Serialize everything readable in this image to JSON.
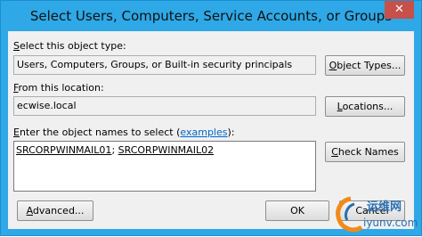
{
  "window": {
    "title": "Select Users, Computers, Service Accounts, or Groups",
    "close_glyph": "✕"
  },
  "object_type": {
    "label_prefix": "S",
    "label_rest": "elect this object type:",
    "value": "Users, Computers, Groups, or Built-in security principals",
    "button_prefix": "O",
    "button_rest": "bject Types..."
  },
  "location": {
    "label_prefix": "F",
    "label_rest": "rom this location:",
    "value": "ecwise.local",
    "button_prefix": "L",
    "button_rest": "ocations..."
  },
  "names": {
    "label_prefix": "E",
    "label_rest": "nter the object names to select (",
    "examples_link": "examples",
    "label_suffix": "):",
    "name1": "SRCORPWINMAIL01",
    "separator": "; ",
    "name2": "SRCORPWINMAIL02",
    "check_prefix": "C",
    "check_rest": "heck Names"
  },
  "footer": {
    "advanced_prefix": "A",
    "advanced_rest": "dvanced...",
    "ok_label": "OK",
    "cancel_label": "Cancel"
  },
  "watermark": {
    "line1": "运维网",
    "line2": "iyunv.com"
  }
}
